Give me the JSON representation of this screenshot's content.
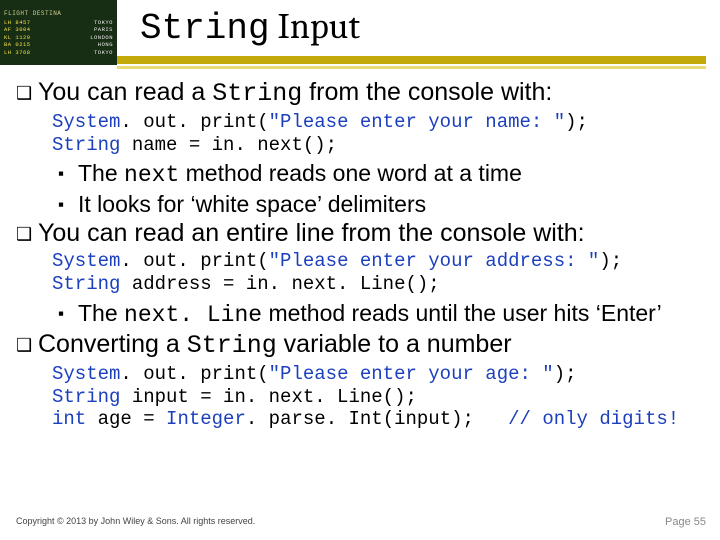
{
  "thumb": {
    "head": "FLIGHT    DESTINA",
    "rows": [
      [
        "LH 8457",
        "TOKYO"
      ],
      [
        "AF 3004",
        "PARIS"
      ],
      [
        "KL 1129",
        "LONDON"
      ],
      [
        "BA 0215",
        "HONG"
      ],
      [
        "LH 3768",
        "TOKYO"
      ]
    ]
  },
  "title": {
    "pre": "String",
    "post": " Input"
  },
  "sections": [
    {
      "heading_parts": [
        "You can read a ",
        "String",
        " from the console with:"
      ],
      "code": [
        [
          [
            "System",
            "b"
          ],
          [
            ". out. print(",
            ""
          ],
          [
            "\"Please enter your name: \"",
            "b"
          ],
          [
            "); ",
            ""
          ]
        ],
        [
          [
            "String",
            "b"
          ],
          [
            " name = in. next(); ",
            ""
          ]
        ]
      ],
      "subs": [
        {
          "parts": [
            "The ",
            "next",
            " method reads one word at a time"
          ]
        },
        {
          "parts": [
            "It looks for ‘white space’ delimiters"
          ]
        }
      ]
    },
    {
      "heading_parts": [
        "You can read an entire line from the console with:"
      ],
      "code": [
        [
          [
            "System",
            "b"
          ],
          [
            ". out. print(",
            ""
          ],
          [
            "\"Please enter your address: \"",
            "b"
          ],
          [
            "); ",
            ""
          ]
        ],
        [
          [
            "String",
            "b"
          ],
          [
            " address = in. next. Line(); ",
            ""
          ]
        ]
      ],
      "subs": [
        {
          "parts": [
            "The ",
            "next. Line",
            " method reads until the user hits ‘Enter’"
          ]
        }
      ]
    },
    {
      "heading_parts": [
        "Converting a ",
        "String",
        " variable to a number"
      ],
      "code": [
        [
          [
            "System",
            "b"
          ],
          [
            ". out. print(",
            ""
          ],
          [
            "\"Please enter your age: \"",
            "b"
          ],
          [
            "); ",
            ""
          ]
        ],
        [
          [
            "String",
            "b"
          ],
          [
            " input = in. next. Line(); ",
            ""
          ]
        ],
        [
          [
            "int",
            "b"
          ],
          [
            " age = ",
            ""
          ],
          [
            "Integer",
            "b"
          ],
          [
            ". parse. Int(input);   ",
            ""
          ],
          [
            "// only digits!",
            "b"
          ]
        ]
      ],
      "subs": []
    }
  ],
  "footer": {
    "copyright": "Copyright © 2013 by John Wiley & Sons. All rights reserved.",
    "page": "Page 55"
  }
}
